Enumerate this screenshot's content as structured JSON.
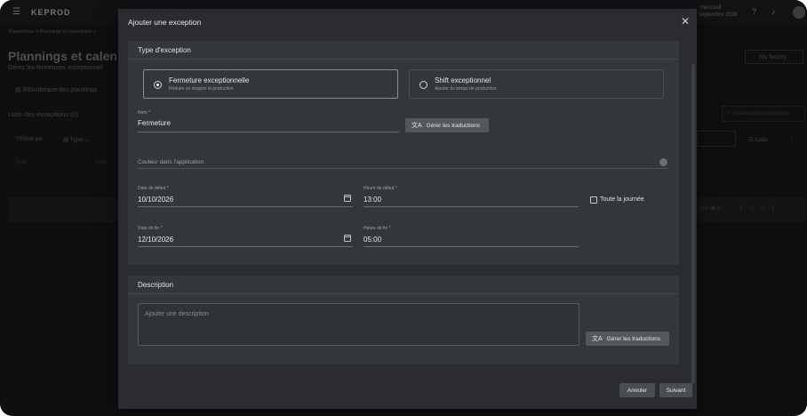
{
  "background": {
    "logo": "KEPROD",
    "datetime_top": "mercredi",
    "datetime_bottom": "septembre 2026",
    "breadcrumb": "Paramètres  >  Plannings et calendriers  >",
    "page_title": "Plannings et calen",
    "page_subtitle": "Gérez les fermetures exceptionnel",
    "tab_library": "Bibliothèque des plannings",
    "list_title": "Liste des exceptions (0)",
    "filter_label": "Filtrer par",
    "type_filter": "Type",
    "col_type": "Type",
    "col_name": "Nom",
    "factory": "My factory",
    "add_exception": "+ Ajouter une exception",
    "view_list": "Liste",
    "pagination": "0-0 de 0",
    "accent_color": "#d0312d"
  },
  "modal": {
    "title": "Ajouter une exception",
    "close_icon": "close-icon",
    "type_section": {
      "title": "Type d'exception",
      "options": [
        {
          "title": "Fermeture exceptionnelle",
          "subtitle": "Réduire ou stopper la production",
          "selected": true
        },
        {
          "title": "Shift exceptionnel",
          "subtitle": "Ajouter du temps de production",
          "selected": false
        }
      ],
      "name_label": "Nom *",
      "name_value": "Fermeture",
      "translate_button": "Gérer les traductions",
      "color_label": "Couleur dans l'application",
      "start_date_label": "Date de début *",
      "start_date_value": "10/10/2026",
      "start_time_label": "Heure de début *",
      "start_time_value": "13:00",
      "all_day_label": "Toute la journée",
      "end_date_label": "Date de fin *",
      "end_date_value": "12/10/2026",
      "end_time_label": "Heure de fin *",
      "end_time_value": "05:00"
    },
    "description_section": {
      "title": "Description",
      "placeholder": "Ajouter une description",
      "translate_button": "Gérer les traductions"
    },
    "footer": {
      "cancel": "Annuler",
      "next": "Suivant"
    }
  }
}
